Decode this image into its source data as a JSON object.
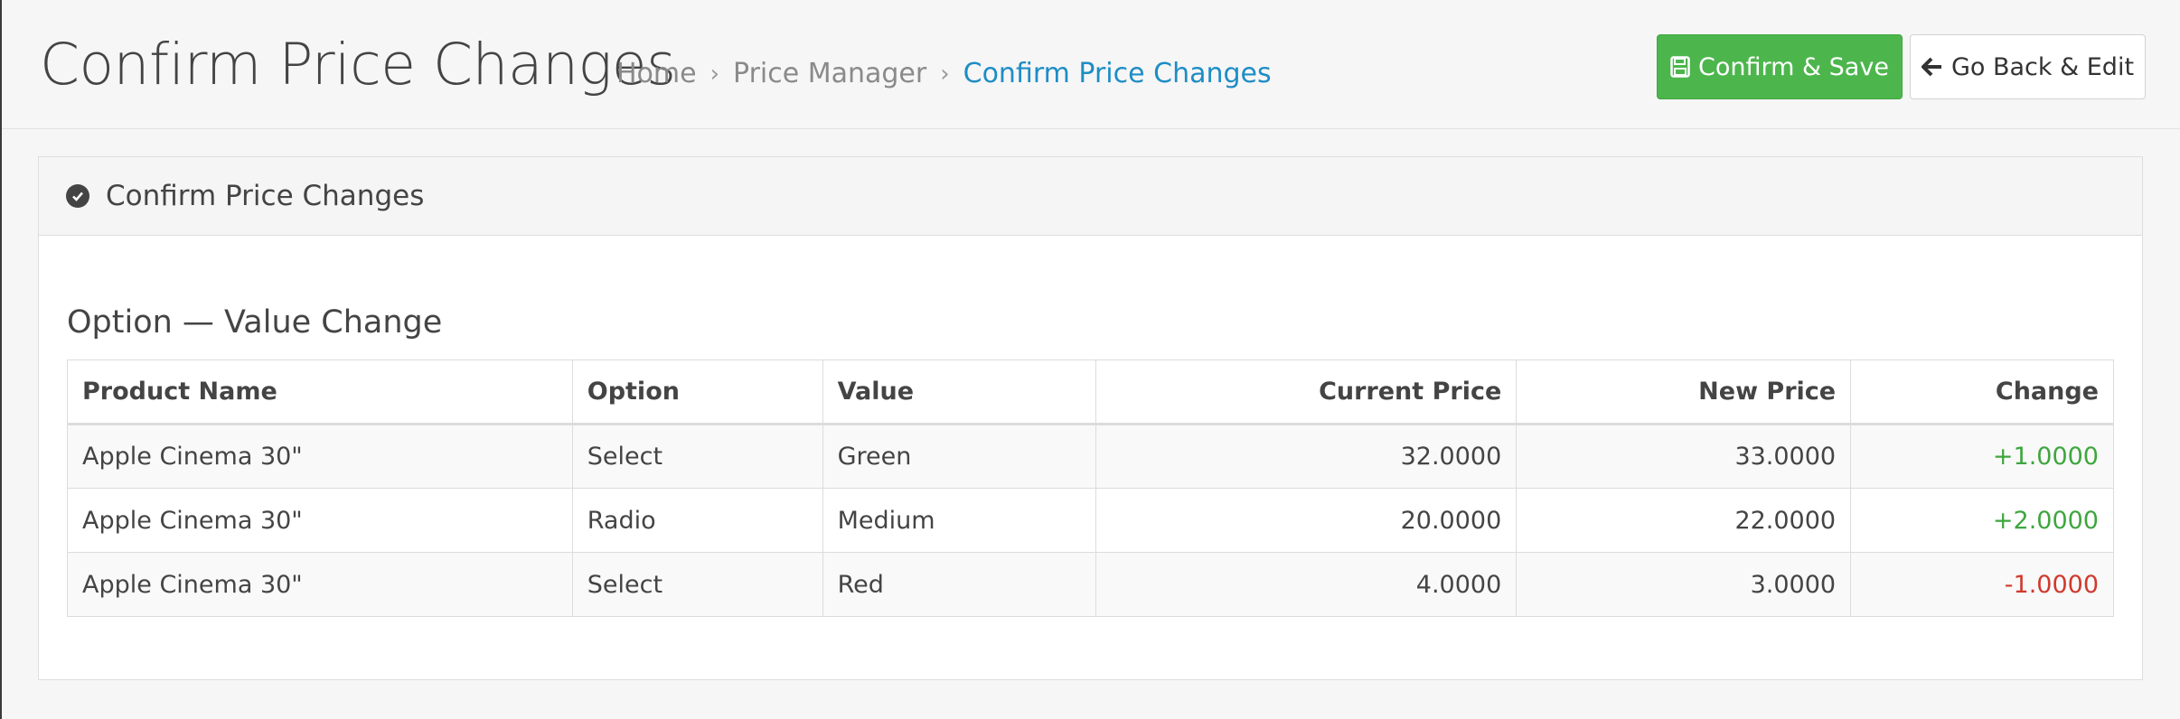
{
  "page": {
    "title": "Confirm Price Changes",
    "breadcrumb": [
      {
        "label": "Home"
      },
      {
        "label": "Price Manager"
      },
      {
        "label": "Confirm Price Changes"
      }
    ]
  },
  "actions": {
    "save_label": "Confirm & Save",
    "back_label": "Go Back & Edit",
    "save_color": "#4cb64c"
  },
  "panel": {
    "title": "Confirm Price Changes",
    "icon": "check-circle-icon"
  },
  "section": {
    "title": "Option — Value Change"
  },
  "table": {
    "headers": [
      "Product Name",
      "Option",
      "Value",
      "Current Price",
      "New Price",
      "Change"
    ],
    "rows": [
      [
        "Apple Cinema 30\"",
        "Select",
        "Green",
        "32.0000",
        "33.0000",
        "+1.0000"
      ],
      [
        "Apple Cinema 30\"",
        "Radio",
        "Medium",
        "20.0000",
        "22.0000",
        "+2.0000"
      ],
      [
        "Apple Cinema 30\"",
        "Select",
        "Red",
        "4.0000",
        "3.0000",
        "-1.0000"
      ]
    ]
  },
  "colors": {
    "positive": "#3fa63f",
    "negative": "#d03a2e",
    "link": "#1e8dc5"
  }
}
